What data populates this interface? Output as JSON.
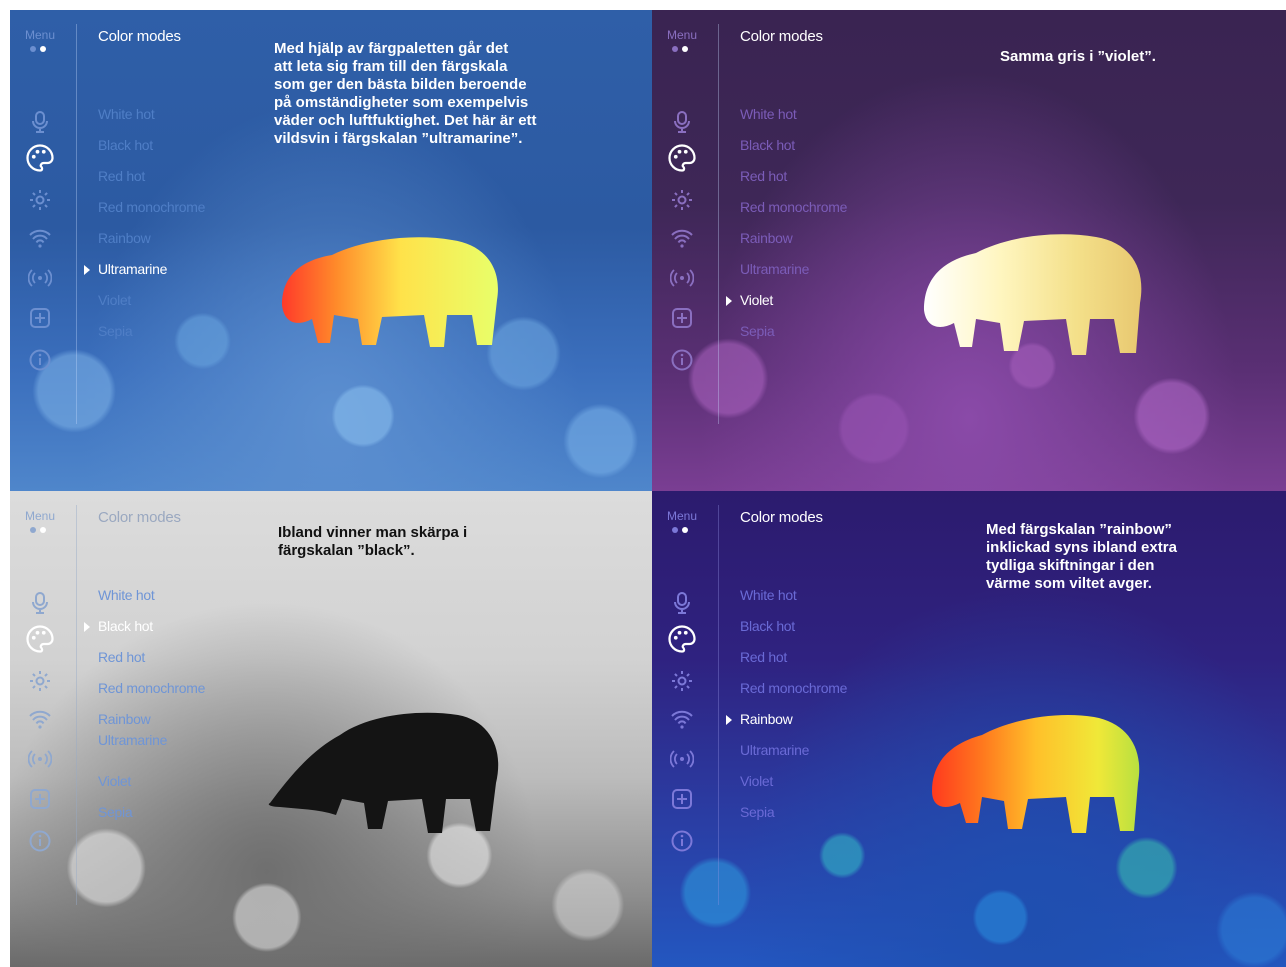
{
  "menu": {
    "label": "Menu",
    "title": "Color modes",
    "modes": [
      "White hot",
      "Black hot",
      "Red hot",
      "Red monochrome",
      "Rainbow",
      "Ultramarine",
      "Violet",
      "Sepia"
    ],
    "icons": [
      "microphone-icon",
      "palette-icon",
      "gear-icon",
      "wifi-icon",
      "broadcast-icon",
      "plus-box-icon",
      "info-icon"
    ]
  },
  "panels": [
    {
      "palette": "Ultramarine",
      "selected_mode": "Ultramarine",
      "caption": "Med hjälp av färgpaletten går det att leta sig fram till den färgskala som ger den bästa bilden beroende på omständigheter som exempelvis väder och luftfuktighet. Det här är ett vildsvin i färgskalan ”ultramarine”.",
      "caption_lines": [
        "Med hjälp av färgpaletten går det",
        "att leta sig fram till den färgskala",
        "som ger den bästa bilden beroende",
        "på omständigheter som exempelvis",
        "väder och luftfuktighet. Det här är ett",
        "vildsvin i färgskalan ”ultramarine”."
      ],
      "accent": "#2f5fa8"
    },
    {
      "palette": "Violet",
      "selected_mode": "Violet",
      "caption_lines": [
        "Samma gris i ”violet”."
      ],
      "accent": "#3e2757"
    },
    {
      "palette": "Black hot",
      "selected_mode": "Black hot",
      "caption_lines": [
        "Ibland vinner man skärpa i",
        "färgskalan ”black”."
      ],
      "accent": "#d2d2d2"
    },
    {
      "palette": "Rainbow",
      "selected_mode": "Rainbow",
      "caption_lines": [
        "Med färgskalan ”rainbow”",
        "inklickad syns ibland extra",
        "tydliga skiftningar i den",
        "värme som viltet avger."
      ],
      "accent": "#2c1b6e"
    }
  ]
}
